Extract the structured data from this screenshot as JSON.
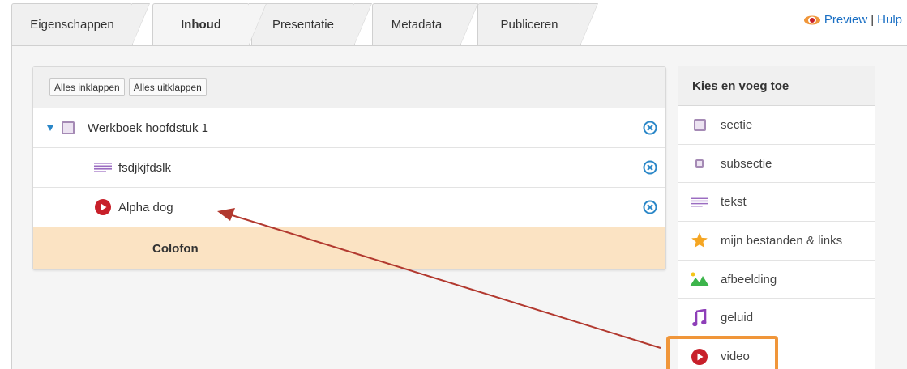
{
  "tabs": [
    {
      "label": "Eigenschappen",
      "active": false
    },
    {
      "label": "Inhoud",
      "active": true
    },
    {
      "label": "Presentatie",
      "active": false
    },
    {
      "label": "Metadata",
      "active": false
    },
    {
      "label": "Publiceren",
      "active": false
    }
  ],
  "toplinks": {
    "preview": "Preview",
    "separator": "|",
    "help": "Hulp"
  },
  "tree": {
    "collapse_all": "Alles inklappen",
    "expand_all": "Alles uitklappen",
    "rows": [
      {
        "label": "Werkboek hoofdstuk 1",
        "type": "sectie",
        "icon": "section-square-icon"
      },
      {
        "label": "fsdjkjfdslk",
        "type": "tekst",
        "icon": "text-lines-icon"
      },
      {
        "label": "Alpha dog",
        "type": "video",
        "icon": "video-play-icon"
      }
    ],
    "colofon": "Colofon"
  },
  "palette": {
    "title": "Kies en voeg toe",
    "items": [
      {
        "label": "sectie",
        "icon": "section-square-icon"
      },
      {
        "label": "subsectie",
        "icon": "subsection-square-icon"
      },
      {
        "label": "tekst",
        "icon": "text-lines-icon"
      },
      {
        "label": "mijn bestanden & links",
        "icon": "star-icon"
      },
      {
        "label": "afbeelding",
        "icon": "image-mountain-icon"
      },
      {
        "label": "geluid",
        "icon": "music-note-icon"
      },
      {
        "label": "video",
        "icon": "video-play-icon"
      }
    ]
  },
  "colors": {
    "accent_blue": "#2a87c8",
    "link_blue": "#1a6fc4",
    "video_red": "#c8202a",
    "purple": "#8e63b0",
    "colofon_bg": "#fbe3c3",
    "highlight_orange": "#f0963a",
    "arrow_red": "#b2392f"
  }
}
